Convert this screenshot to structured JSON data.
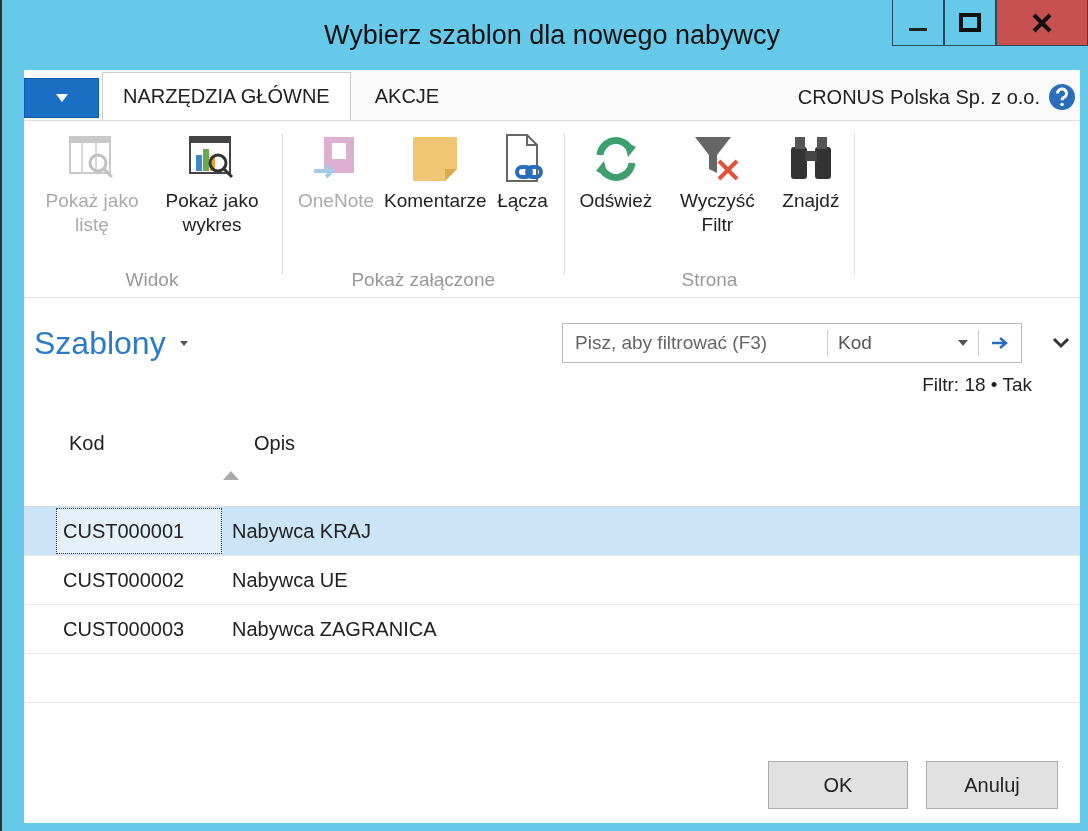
{
  "window": {
    "title": "Wybierz szablon dla nowego nabywcy"
  },
  "ribbon": {
    "tabs": [
      {
        "label": "NARZĘDZIA GŁÓWNE",
        "selected": true
      },
      {
        "label": "AKCJE",
        "selected": false
      }
    ],
    "company": "CRONUS Polska Sp. z o.o.",
    "groups": [
      {
        "label": "Widok",
        "actions": [
          {
            "label": "Pokaż jako listę",
            "kind": "list-view",
            "disabled": true
          },
          {
            "label": "Pokaż jako wykres",
            "kind": "chart-view",
            "disabled": false
          }
        ]
      },
      {
        "label": "Pokaż załączone",
        "actions": [
          {
            "label": "OneNote",
            "kind": "onenote",
            "disabled": true
          },
          {
            "label": "Komentarze",
            "kind": "note",
            "disabled": false
          },
          {
            "label": "Łącza",
            "kind": "link",
            "disabled": false
          }
        ]
      },
      {
        "label": "Strona",
        "actions": [
          {
            "label": "Odśwież",
            "kind": "refresh",
            "disabled": false
          },
          {
            "label": "Wyczyść Filtr",
            "kind": "clear-filter",
            "disabled": false
          },
          {
            "label": "Znajdź",
            "kind": "find",
            "disabled": false
          }
        ]
      }
    ]
  },
  "page": {
    "title": "Szablony",
    "filter": {
      "placeholder": "Pisz, aby filtrować (F3)",
      "field": "Kod"
    },
    "filter_status": "Filtr: 18 • Tak"
  },
  "table": {
    "columns": [
      {
        "label": "Kod",
        "sorted": true
      },
      {
        "label": "Opis",
        "sorted": false
      }
    ],
    "rows": [
      {
        "code": "CUST000001",
        "description": "Nabywca KRAJ",
        "selected": true
      },
      {
        "code": "CUST000002",
        "description": "Nabywca UE",
        "selected": false
      },
      {
        "code": "CUST000003",
        "description": "Nabywca ZAGRANICA",
        "selected": false
      }
    ]
  },
  "buttons": [
    "OK",
    "Anuluj"
  ]
}
